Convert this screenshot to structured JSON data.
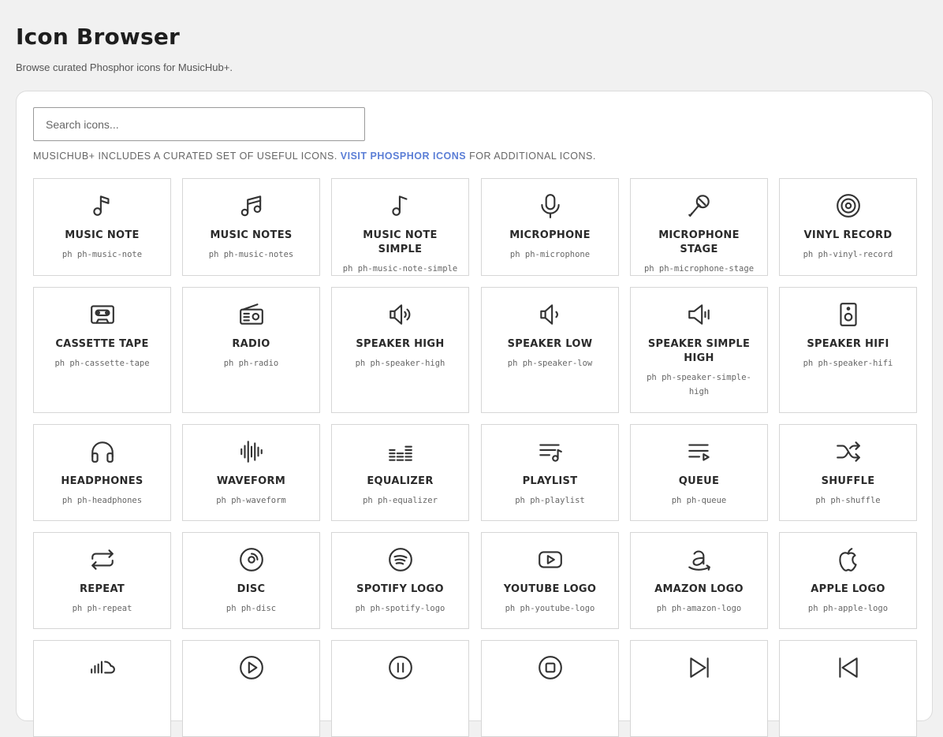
{
  "header": {
    "title": "Icon Browser",
    "subtitle": "Browse curated Phosphor icons for MusicHub+."
  },
  "search": {
    "placeholder": "Search icons..."
  },
  "notice": {
    "before": "MusicHub+ includes a curated set of useful icons.",
    "link": "Visit Phosphor Icons",
    "after": "for additional icons."
  },
  "colors": {
    "accent": "#5b7ed6",
    "icon": "#333333"
  },
  "icons": [
    {
      "name": "Music Note",
      "class": "ph ph-music-note",
      "glyph": "music-note-icon"
    },
    {
      "name": "Music Notes",
      "class": "ph ph-music-notes",
      "glyph": "music-notes-icon"
    },
    {
      "name": "Music Note Simple",
      "class": "ph ph-music-note-simple",
      "glyph": "music-note-simple-icon"
    },
    {
      "name": "Microphone",
      "class": "ph ph-microphone",
      "glyph": "microphone-icon"
    },
    {
      "name": "Microphone Stage",
      "class": "ph ph-microphone-stage",
      "glyph": "microphone-stage-icon"
    },
    {
      "name": "Vinyl Record",
      "class": "ph ph-vinyl-record",
      "glyph": "vinyl-record-icon"
    },
    {
      "name": "Cassette Tape",
      "class": "ph ph-cassette-tape",
      "glyph": "cassette-tape-icon"
    },
    {
      "name": "Radio",
      "class": "ph ph-radio",
      "glyph": "radio-icon"
    },
    {
      "name": "Speaker High",
      "class": "ph ph-speaker-high",
      "glyph": "speaker-high-icon"
    },
    {
      "name": "Speaker Low",
      "class": "ph ph-speaker-low",
      "glyph": "speaker-low-icon"
    },
    {
      "name": "Speaker Simple High",
      "class": "ph ph-speaker-simple-high",
      "glyph": "speaker-simple-high-icon"
    },
    {
      "name": "Speaker Hifi",
      "class": "ph ph-speaker-hifi",
      "glyph": "speaker-hifi-icon"
    },
    {
      "name": "Headphones",
      "class": "ph ph-headphones",
      "glyph": "headphones-icon"
    },
    {
      "name": "Waveform",
      "class": "ph ph-waveform",
      "glyph": "waveform-icon"
    },
    {
      "name": "Equalizer",
      "class": "ph ph-equalizer",
      "glyph": "equalizer-icon"
    },
    {
      "name": "Playlist",
      "class": "ph ph-playlist",
      "glyph": "playlist-icon"
    },
    {
      "name": "Queue",
      "class": "ph ph-queue",
      "glyph": "queue-icon"
    },
    {
      "name": "Shuffle",
      "class": "ph ph-shuffle",
      "glyph": "shuffle-icon"
    },
    {
      "name": "Repeat",
      "class": "ph ph-repeat",
      "glyph": "repeat-icon"
    },
    {
      "name": "Disc",
      "class": "ph ph-disc",
      "glyph": "disc-icon"
    },
    {
      "name": "Spotify Logo",
      "class": "ph ph-spotify-logo",
      "glyph": "spotify-logo-icon"
    },
    {
      "name": "YouTube Logo",
      "class": "ph ph-youtube-logo",
      "glyph": "youtube-logo-icon"
    },
    {
      "name": "Amazon Logo",
      "class": "ph ph-amazon-logo",
      "glyph": "amazon-logo-icon"
    },
    {
      "name": "Apple Logo",
      "class": "ph ph-apple-logo",
      "glyph": "apple-logo-icon"
    },
    {
      "name": "",
      "class": "",
      "glyph": "soundcloud-logo-icon"
    },
    {
      "name": "",
      "class": "",
      "glyph": "play-circle-icon"
    },
    {
      "name": "",
      "class": "",
      "glyph": "pause-circle-icon"
    },
    {
      "name": "",
      "class": "",
      "glyph": "stop-circle-icon"
    },
    {
      "name": "",
      "class": "",
      "glyph": "skip-forward-icon"
    },
    {
      "name": "",
      "class": "",
      "glyph": "skip-back-icon"
    }
  ]
}
